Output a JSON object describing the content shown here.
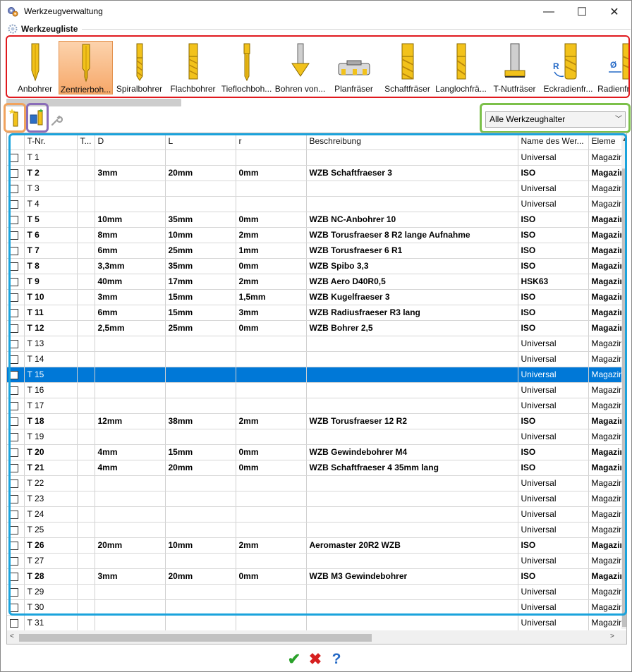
{
  "window": {
    "title": "Werkzeugverwaltung",
    "minimize": "—",
    "maximize": "☐",
    "close": "✕"
  },
  "group": {
    "title": "Werkzeugliste"
  },
  "tools": [
    {
      "label": "Anbohrer"
    },
    {
      "label": "Zentrierboh..."
    },
    {
      "label": "Spiralbohrer"
    },
    {
      "label": "Flachbohrer"
    },
    {
      "label": "Tieflochboh..."
    },
    {
      "label": "Bohren von..."
    },
    {
      "label": "Planfräser"
    },
    {
      "label": "Schaftfräser"
    },
    {
      "label": "Langlochfrä..."
    },
    {
      "label": "T-Nutfräser"
    },
    {
      "label": "Eckradienfr..."
    },
    {
      "label": "Radienfräser"
    }
  ],
  "tool_marks": {
    "eckradius": "R",
    "radius": "Ø"
  },
  "holder_filter": {
    "value": "Alle Werkzeughalter",
    "chevron": "﹀"
  },
  "table": {
    "columns": [
      "",
      "T-Nr.",
      "T...",
      "D",
      "L",
      "r",
      "Beschreibung",
      "Name des Wer...",
      "Eleme"
    ],
    "rows": [
      {
        "t": "T 1",
        "d": "",
        "l": "",
        "r": "",
        "desc": "",
        "name": "Universal",
        "elem": "Magazin",
        "bold": false
      },
      {
        "t": "T 2",
        "d": "3mm",
        "l": "20mm",
        "r": "0mm",
        "desc": "WZB Schaftfraeser 3",
        "name": "ISO",
        "elem": "Magazin",
        "bold": true
      },
      {
        "t": "T 3",
        "d": "",
        "l": "",
        "r": "",
        "desc": "",
        "name": "Universal",
        "elem": "Magazin",
        "bold": false
      },
      {
        "t": "T 4",
        "d": "",
        "l": "",
        "r": "",
        "desc": "",
        "name": "Universal",
        "elem": "Magazin",
        "bold": false
      },
      {
        "t": "T 5",
        "d": "10mm",
        "l": "35mm",
        "r": "0mm",
        "desc": "WZB NC-Anbohrer 10",
        "name": "ISO",
        "elem": "Magazin",
        "bold": true
      },
      {
        "t": "T 6",
        "d": "8mm",
        "l": "10mm",
        "r": "2mm",
        "desc": "WZB Torusfraeser 8 R2 lange Aufnahme",
        "name": "ISO",
        "elem": "Magazin",
        "bold": true
      },
      {
        "t": "T 7",
        "d": "6mm",
        "l": "25mm",
        "r": "1mm",
        "desc": "WZB Torusfraeser 6 R1",
        "name": "ISO",
        "elem": "Magazin",
        "bold": true
      },
      {
        "t": "T 8",
        "d": "3,3mm",
        "l": "35mm",
        "r": "0mm",
        "desc": "WZB Spibo 3,3",
        "name": "ISO",
        "elem": "Magazin",
        "bold": true
      },
      {
        "t": "T 9",
        "d": "40mm",
        "l": "17mm",
        "r": "2mm",
        "desc": "WZB Aero D40R0,5",
        "name": "HSK63",
        "elem": "Magazin",
        "bold": true
      },
      {
        "t": "T 10",
        "d": "3mm",
        "l": "15mm",
        "r": "1,5mm",
        "desc": "WZB Kugelfraeser 3",
        "name": "ISO",
        "elem": "Magazin",
        "bold": true
      },
      {
        "t": "T 11",
        "d": "6mm",
        "l": "15mm",
        "r": "3mm",
        "desc": "WZB Radiusfraeser R3 lang",
        "name": "ISO",
        "elem": "Magazin",
        "bold": true
      },
      {
        "t": "T 12",
        "d": "2,5mm",
        "l": "25mm",
        "r": "0mm",
        "desc": "WZB Bohrer 2,5",
        "name": "ISO",
        "elem": "Magazin",
        "bold": true
      },
      {
        "t": "T 13",
        "d": "",
        "l": "",
        "r": "",
        "desc": "",
        "name": "Universal",
        "elem": "Magazin",
        "bold": false
      },
      {
        "t": "T 14",
        "d": "",
        "l": "",
        "r": "",
        "desc": "",
        "name": "Universal",
        "elem": "Magazin",
        "bold": false
      },
      {
        "t": "T 15",
        "d": "",
        "l": "",
        "r": "",
        "desc": "",
        "name": "Universal",
        "elem": "Magazin",
        "bold": false,
        "selected": true
      },
      {
        "t": "T 16",
        "d": "",
        "l": "",
        "r": "",
        "desc": "",
        "name": "Universal",
        "elem": "Magazin",
        "bold": false
      },
      {
        "t": "T 17",
        "d": "",
        "l": "",
        "r": "",
        "desc": "",
        "name": "Universal",
        "elem": "Magazin",
        "bold": false
      },
      {
        "t": "T 18",
        "d": "12mm",
        "l": "38mm",
        "r": "2mm",
        "desc": "WZB Torusfraeser 12 R2",
        "name": "ISO",
        "elem": "Magazin",
        "bold": true
      },
      {
        "t": "T 19",
        "d": "",
        "l": "",
        "r": "",
        "desc": "",
        "name": "Universal",
        "elem": "Magazin",
        "bold": false
      },
      {
        "t": "T 20",
        "d": "4mm",
        "l": "15mm",
        "r": "0mm",
        "desc": "WZB Gewindebohrer M4",
        "name": "ISO",
        "elem": "Magazin",
        "bold": true
      },
      {
        "t": "T 21",
        "d": "4mm",
        "l": "20mm",
        "r": "0mm",
        "desc": "WZB Schaftfraeser 4 35mm lang",
        "name": "ISO",
        "elem": "Magazin",
        "bold": true
      },
      {
        "t": "T 22",
        "d": "",
        "l": "",
        "r": "",
        "desc": "",
        "name": "Universal",
        "elem": "Magazin",
        "bold": false
      },
      {
        "t": "T 23",
        "d": "",
        "l": "",
        "r": "",
        "desc": "",
        "name": "Universal",
        "elem": "Magazin",
        "bold": false
      },
      {
        "t": "T 24",
        "d": "",
        "l": "",
        "r": "",
        "desc": "",
        "name": "Universal",
        "elem": "Magazin",
        "bold": false
      },
      {
        "t": "T 25",
        "d": "",
        "l": "",
        "r": "",
        "desc": "",
        "name": "Universal",
        "elem": "Magazin",
        "bold": false
      },
      {
        "t": "T 26",
        "d": "20mm",
        "l": "10mm",
        "r": "2mm",
        "desc": "Aeromaster 20R2 WZB",
        "name": "ISO",
        "elem": "Magazin",
        "bold": true
      },
      {
        "t": "T 27",
        "d": "",
        "l": "",
        "r": "",
        "desc": "",
        "name": "Universal",
        "elem": "Magazin",
        "bold": false
      },
      {
        "t": "T 28",
        "d": "3mm",
        "l": "20mm",
        "r": "0mm",
        "desc": "WZB M3 Gewindebohrer",
        "name": "ISO",
        "elem": "Magazin",
        "bold": true
      },
      {
        "t": "T 29",
        "d": "",
        "l": "",
        "r": "",
        "desc": "",
        "name": "Universal",
        "elem": "Magazin",
        "bold": false
      },
      {
        "t": "T 30",
        "d": "",
        "l": "",
        "r": "",
        "desc": "",
        "name": "Universal",
        "elem": "Magazin",
        "bold": false
      },
      {
        "t": "T 31",
        "d": "",
        "l": "",
        "r": "",
        "desc": "",
        "name": "Universal",
        "elem": "Magazin",
        "bold": false
      }
    ]
  },
  "scroll": {
    "up": "▲",
    "left": "<",
    "right": ">"
  },
  "buttons": {
    "ok": "✔",
    "cancel": "✖",
    "help": "?"
  },
  "colors": {
    "selection": "#0078d7",
    "tool_gold": "#f2c21b",
    "palette_frame": "#e0191e",
    "table_frame": "#1aa3dc",
    "filter_frame": "#7cc04a"
  }
}
